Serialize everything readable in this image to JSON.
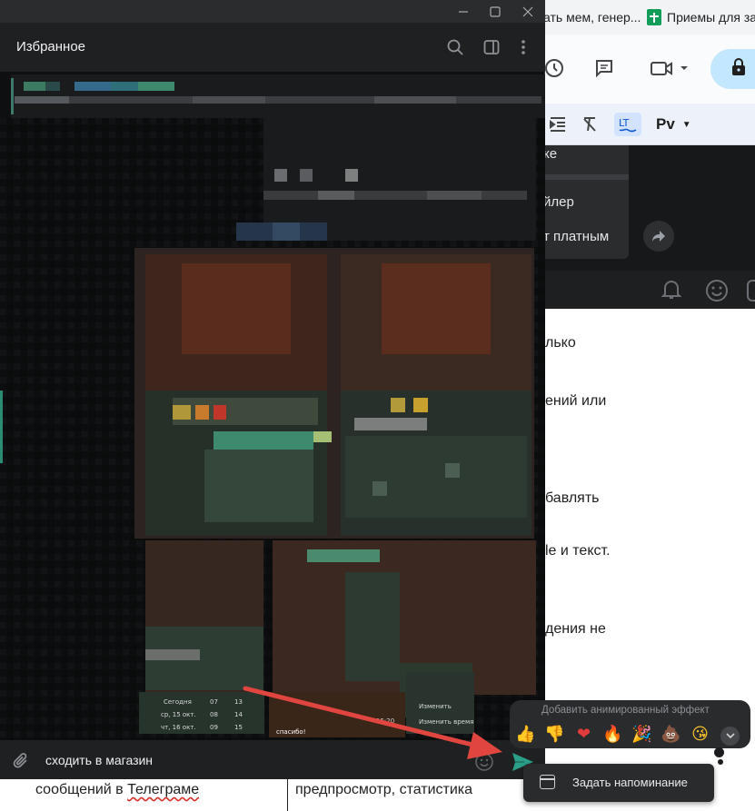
{
  "background_browser": {
    "bookmarks": [
      {
        "label": "ать мем, генер..."
      },
      {
        "label": "Приемы для за"
      }
    ],
    "context_menu_items": [
      "ке",
      "йлер",
      "т платным"
    ],
    "document_lines": [
      "лько",
      "ений или",
      "бавлять",
      "le и текст.",
      "дения не"
    ],
    "table_row": {
      "col1": "сообщений в Телеграме",
      "col1_misspelled": "Телеграме",
      "col2": "предпросмотр, статистика"
    },
    "toolbar_font_style": "Рv"
  },
  "telegram": {
    "chat_title": "Избранное",
    "message_input": {
      "value": "сходить в магазин"
    },
    "preview_table": {
      "rows": [
        {
          "day": "Сегодня",
          "a": "07",
          "b": "13"
        },
        {
          "day": "ср, 15 окт.",
          "a": "08",
          "b": "14"
        },
        {
          "day": "чт, 16 окт.",
          "a": "09",
          "b": "15"
        }
      ],
      "menu_items": [
        "Изменить",
        "Изменить время"
      ],
      "bubble_text": "спасибо!",
      "bubble_time": "15:20"
    }
  },
  "reactions_popup": {
    "title": "Добавить анимированный эффект",
    "emojis": [
      {
        "name": "thumbs-up",
        "glyph": "👍"
      },
      {
        "name": "thumbs-down",
        "glyph": "👎"
      },
      {
        "name": "heart",
        "glyph": "❤"
      },
      {
        "name": "fire",
        "glyph": "🔥"
      },
      {
        "name": "party-popper",
        "glyph": "🎉"
      },
      {
        "name": "poo",
        "glyph": "💩"
      },
      {
        "name": "face-kiss",
        "glyph": "😘"
      }
    ]
  },
  "reminder_menu": {
    "label": "Задать напоминание"
  },
  "colors": {
    "accent_teal": "#2aa089",
    "arrow": "#e0463f",
    "popup_bg": "#2a2b2d"
  }
}
